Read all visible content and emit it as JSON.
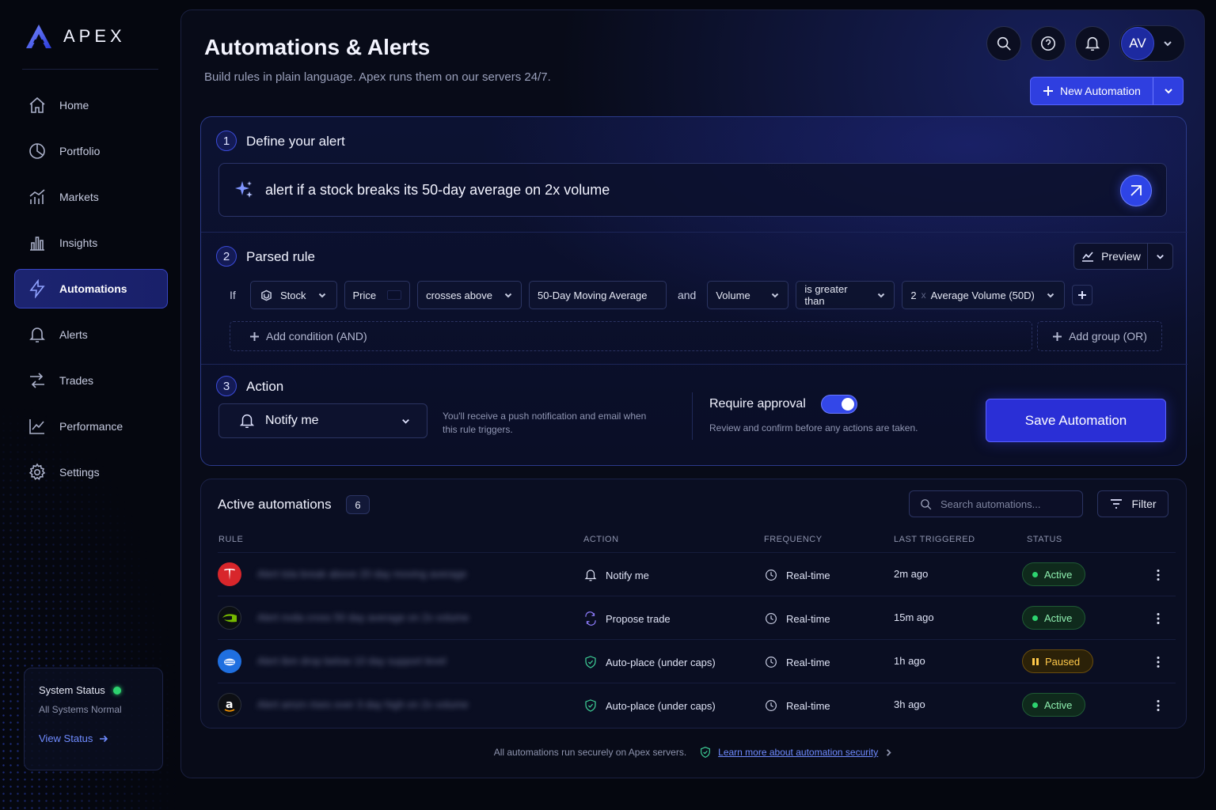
{
  "brand": {
    "name": "APEX"
  },
  "sidebar": {
    "items": [
      {
        "label": "Home",
        "icon": "home-icon"
      },
      {
        "label": "Portfolio",
        "icon": "pie-chart-icon"
      },
      {
        "label": "Markets",
        "icon": "bar-line-chart-icon"
      },
      {
        "label": "Insights",
        "icon": "bar-chart-icon"
      },
      {
        "label": "Automations",
        "icon": "lightning-icon",
        "active": true
      },
      {
        "label": "Alerts",
        "icon": "bell-icon"
      },
      {
        "label": "Trades",
        "icon": "swap-icon"
      },
      {
        "label": "Performance",
        "icon": "trend-icon"
      },
      {
        "label": "Settings",
        "icon": "gear-icon"
      }
    ],
    "status": {
      "title": "System Status",
      "subtitle": "All Systems Normal",
      "link": "View Status"
    }
  },
  "header": {
    "title": "Automations & Alerts",
    "subtitle": "Build rules in plain language. Apex runs them on our servers 24/7.",
    "avatar_initials": "AV",
    "new_automation_label": "New Automation"
  },
  "builder": {
    "step1": {
      "number": "1",
      "label": "Define your alert"
    },
    "prompt": "alert if a stock breaks its 50-day average on 2x volume",
    "step2": {
      "number": "2",
      "label": "Parsed rule"
    },
    "preview_label": "Preview",
    "rule": {
      "if_label": "If",
      "asset": "Stock",
      "field": "Price",
      "operator": "crosses above",
      "target": "50-Day Moving Average",
      "joiner": "and",
      "field2": "Volume",
      "operator2": "is greater than",
      "multiplier": "2",
      "times_sign": "x",
      "target2": "Average Volume (50D)"
    },
    "add_condition_label": "Add condition (AND)",
    "add_group_label": "Add group (OR)",
    "step3": {
      "number": "3",
      "label": "Action"
    },
    "action_value": "Notify me",
    "action_help": "You'll receive a push notification and email when this rule triggers.",
    "approval_title": "Require approval",
    "approval_on": true,
    "approval_sub": "Review and confirm before any actions are taken.",
    "save_label": "Save Automation"
  },
  "automations": {
    "title": "Active automations",
    "count": "6",
    "search_placeholder": "Search automations...",
    "filter_label": "Filter",
    "columns": [
      "RULE",
      "ACTION",
      "FREQUENCY",
      "LAST TRIGGERED",
      "STATUS"
    ],
    "rows": [
      {
        "logo": "tesla-logo-icon",
        "rule": "Alert tsla break above 20 day moving average",
        "action": "Notify me",
        "action_icon": "bell-icon",
        "frequency": "Real-time",
        "last": "2m ago",
        "status": "Active"
      },
      {
        "logo": "nvidia-logo-icon",
        "rule": "Alert nvda cross 50 day average on 2x volume",
        "action": "Propose trade",
        "action_icon": "swap-arrows-icon",
        "frequency": "Real-time",
        "last": "15m ago",
        "status": "Active"
      },
      {
        "logo": "ibm-logo-icon",
        "rule": "Alert ibm drop below 10 day support level",
        "action": "Auto-place (under caps)",
        "action_icon": "shield-check-icon",
        "frequency": "Real-time",
        "last": "1h ago",
        "status": "Paused"
      },
      {
        "logo": "amazon-logo-icon",
        "rule": "Alert amzn rises over 3 day high on 2x volume",
        "action": "Auto-place (under caps)",
        "action_icon": "shield-check-icon",
        "frequency": "Real-time",
        "last": "3h ago",
        "status": "Active"
      }
    ]
  },
  "footer": {
    "text": "All automations run securely on Apex servers.",
    "link": "Learn more about automation security"
  },
  "colors": {
    "accent": "#2f3fe0",
    "active_green": "#2dd36f",
    "paused_amber": "#ffc94a",
    "background": "#05070f"
  }
}
